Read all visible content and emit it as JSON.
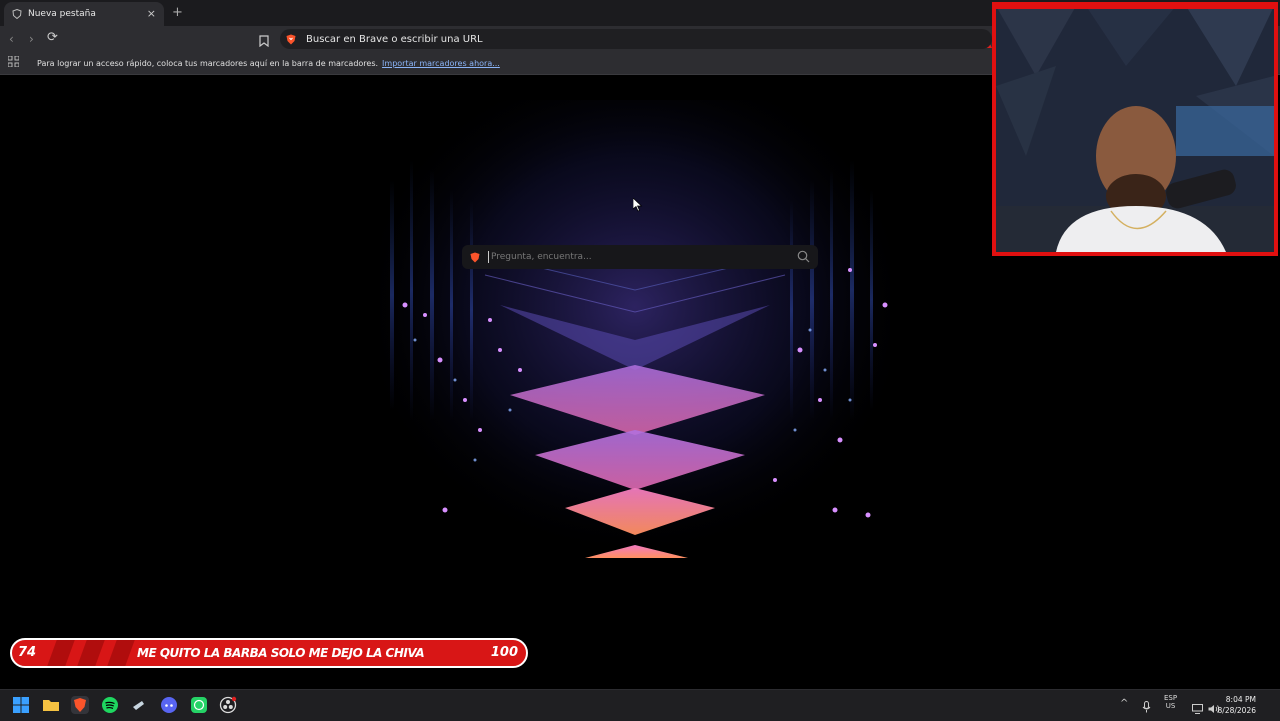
{
  "tab": {
    "title": "Nueva pestaña",
    "close": "×",
    "new_tab": "+"
  },
  "toolbar": {
    "back": "‹",
    "forward": "›",
    "reload": "⟳"
  },
  "urlbar": {
    "placeholder": "Buscar en Brave o escribir una URL"
  },
  "bookmarks": {
    "message": "Para lograr un acceso rápido, coloca tus marcadores aquí en la barra de marcadores.",
    "import_link": "Importar marcadores ahora..."
  },
  "search": {
    "placeholder": "Pregunta, encuentra..."
  },
  "banner": {
    "left_number": "74",
    "text": "ME QUITO LA BARBA SOLO ME DEJO LA CHIVA",
    "right_number": "100"
  },
  "taskbar": {
    "icons": [
      "windows-start-icon",
      "file-explorer-icon",
      "brave-browser-icon",
      "spotify-icon",
      "steam-icon",
      "discord-icon",
      "whatsapp-icon",
      "obs-icon"
    ],
    "lang": "ESP",
    "region": "US",
    "time": "8:04 PM",
    "date": "8/28/2026"
  },
  "colors": {
    "accent": "#d81616",
    "brave": "#fb542b"
  }
}
